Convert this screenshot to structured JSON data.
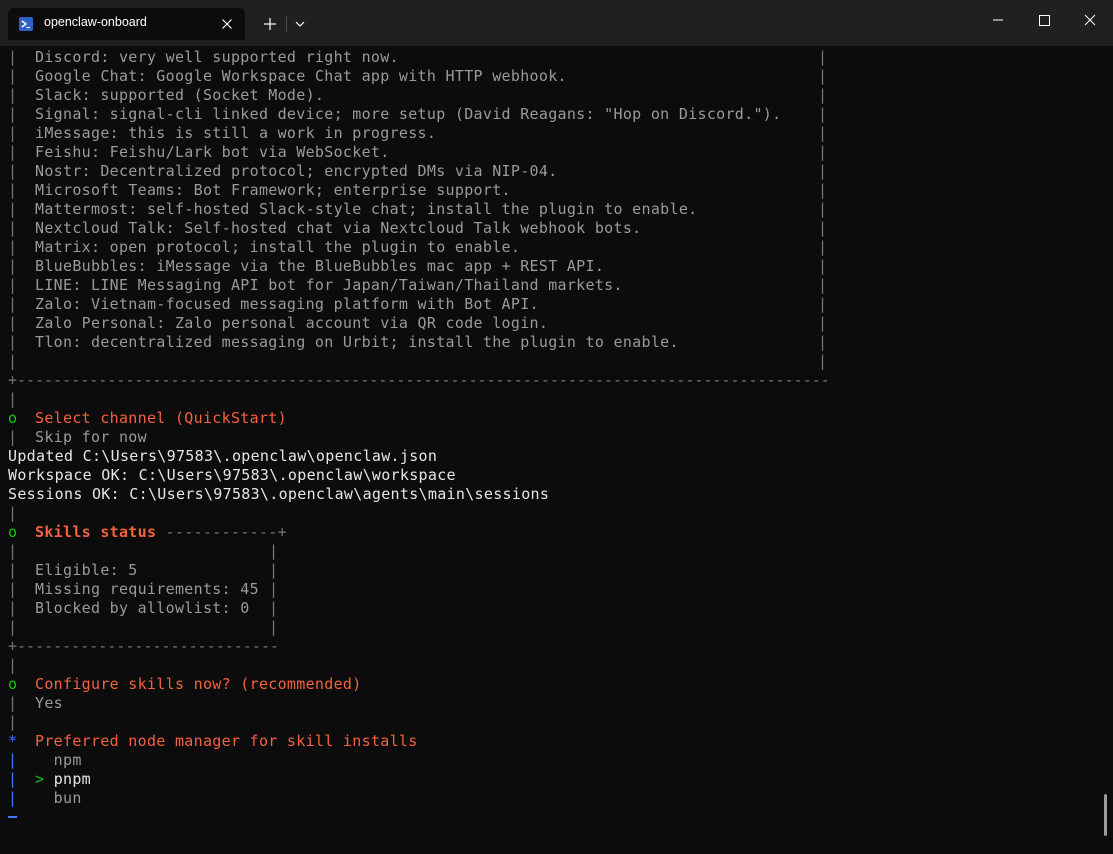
{
  "window": {
    "tab_title": "openclaw-onboard",
    "tab_icon": "powershell-icon",
    "accent": "#2d63c9"
  },
  "channels": [
    "Discord: very well supported right now.",
    "Google Chat: Google Workspace Chat app with HTTP webhook.",
    "Slack: supported (Socket Mode).",
    "Signal: signal-cli linked device; more setup (David Reagans: \"Hop on Discord.\").",
    "iMessage: this is still a work in progress.",
    "Feishu: Feishu/Lark bot via WebSocket.",
    "Nostr: Decentralized protocol; encrypted DMs via NIP-04.",
    "Microsoft Teams: Bot Framework; enterprise support.",
    "Mattermost: self-hosted Slack-style chat; install the plugin to enable.",
    "Nextcloud Talk: Self-hosted chat via Nextcloud Talk webhook bots.",
    "Matrix: open protocol; install the plugin to enable.",
    "BlueBubbles: iMessage via the BlueBubbles mac app + REST API.",
    "LINE: LINE Messaging API bot for Japan/Taiwan/Thailand markets.",
    "Zalo: Vietnam-focused messaging platform with Bot API.",
    "Zalo Personal: Zalo personal account via QR code login.",
    "Tlon: decentralized messaging on Urbit; install the plugin to enable."
  ],
  "select_channel": {
    "prompt": "Select channel (QuickStart)",
    "answer": "Skip for now"
  },
  "status_lines": [
    "Updated C:\\Users\\97583\\.openclaw\\openclaw.json",
    "Workspace OK: C:\\Users\\97583\\.openclaw\\workspace",
    "Sessions OK: C:\\Users\\97583\\.openclaw\\agents\\main\\sessions"
  ],
  "skills_status": {
    "title": "Skills status",
    "eligible": "Eligible: 5",
    "missing": "Missing requirements: 45",
    "blocked": "Blocked by allowlist: 0"
  },
  "configure_skills": {
    "prompt": "Configure skills now? (recommended)",
    "answer": "Yes"
  },
  "node_manager": {
    "prompt": "Preferred node manager for skill installs",
    "options": [
      "npm",
      "pnpm",
      "bun"
    ],
    "selected": "pnpm"
  },
  "glyphs": {
    "bar": "|",
    "done_marker": "o",
    "active_marker": "*",
    "pointer": ">"
  },
  "colors": {
    "prompt_orange": "#f5613f",
    "done_green": "#16c60c",
    "active_blue": "#3b78ff",
    "border_gray": "#767676",
    "background": "#0c0c0c"
  }
}
